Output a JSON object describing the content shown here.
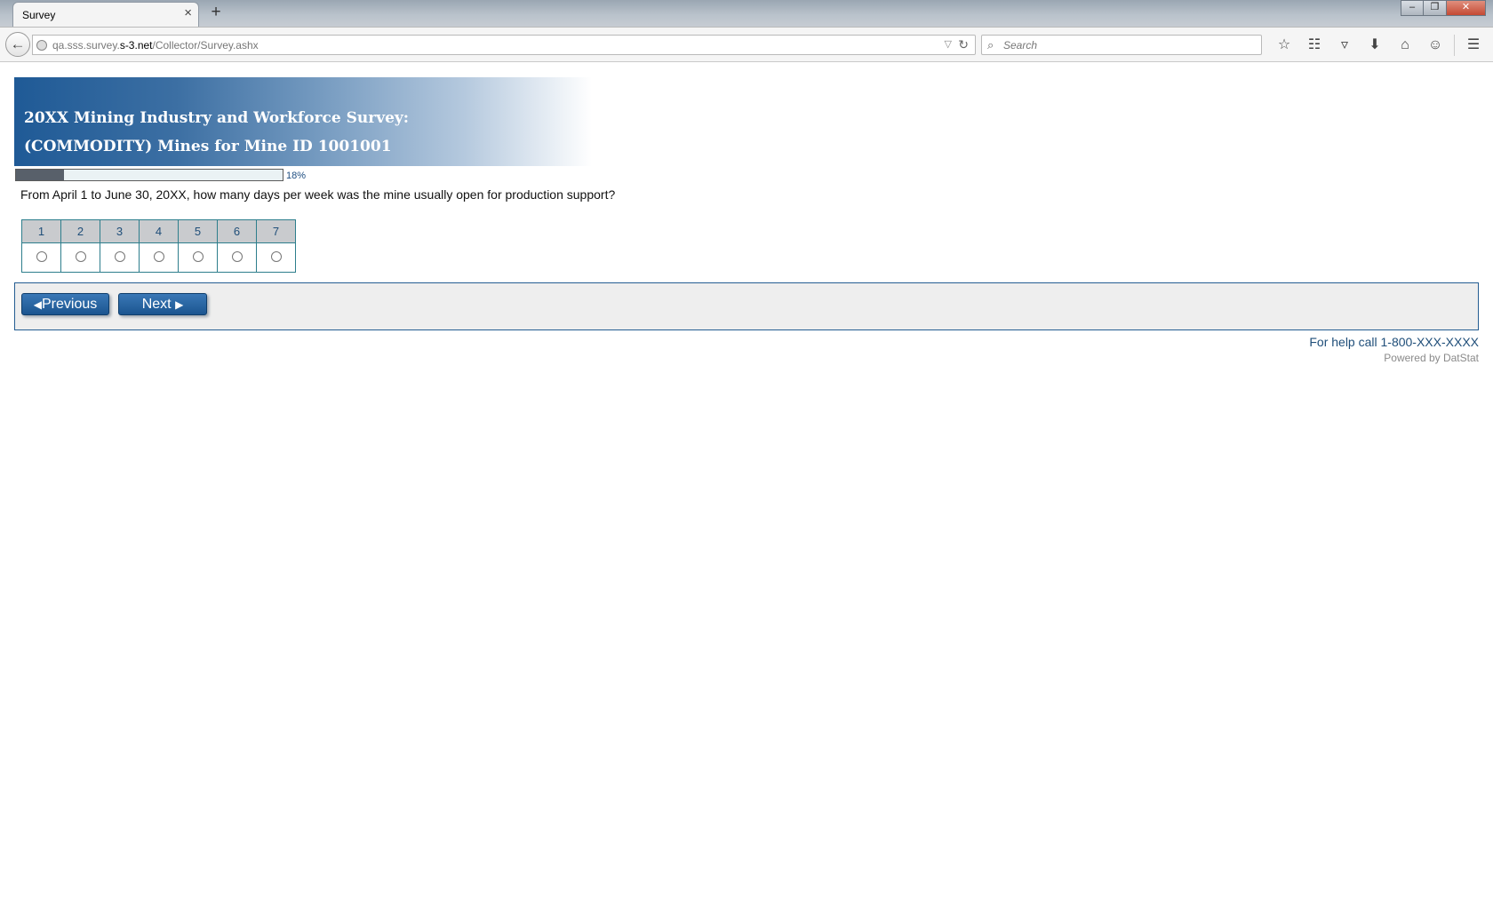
{
  "browser": {
    "tab_title": "Survey",
    "tab_close": "×",
    "new_tab": "+",
    "url_host_prefix": "qa.sss.survey.",
    "url_host": "s-3.net",
    "url_path": "/Collector/Survey.ashx",
    "search_placeholder": "Search",
    "icons": [
      "back-arrow-icon",
      "globe-icon",
      "reload-icon",
      "search-icon",
      "bookmark-star-icon",
      "reading-list-icon",
      "pocket-icon",
      "download-icon",
      "home-icon",
      "chat-icon",
      "menu-icon"
    ]
  },
  "survey": {
    "title_line1": "20XX Mining Industry and Workforce Survey:",
    "title_line2": "(COMMODITY) Mines for Mine ID 1001001",
    "progress_percent": 18,
    "progress_label": "18%",
    "question": "From April 1 to June 30, 20XX, how many days per week was the mine usually open for production support?",
    "options": [
      "1",
      "2",
      "3",
      "4",
      "5",
      "6",
      "7"
    ],
    "selected_option": null,
    "previous_label": "Previous",
    "next_label": "Next",
    "help_text": "For help call 1-800-XXX-XXXX",
    "powered_by": "Powered by DatStat"
  },
  "colors": {
    "banner_dark": "#1f5a96",
    "button_blue": "#1b5590",
    "grid_border": "#2d7e8c",
    "panel_bg": "#eeeeee"
  }
}
